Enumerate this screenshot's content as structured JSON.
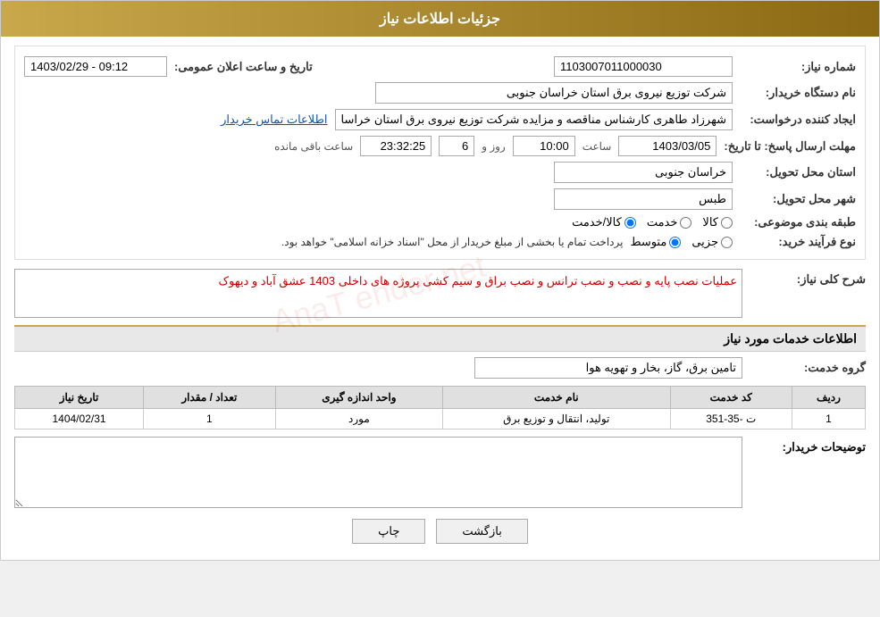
{
  "header": {
    "title": "جزئیات اطلاعات نیاز"
  },
  "form": {
    "need_number_label": "شماره نیاز:",
    "need_number_value": "1103007011000030",
    "announce_date_label": "تاریخ و ساعت اعلان عمومی:",
    "announce_date_value": "1403/02/29 - 09:12",
    "buyer_org_label": "نام دستگاه خریدار:",
    "buyer_org_value": "شرکت توزیع نیروی برق استان خراسان جنوبی",
    "creator_label": "ایجاد کننده درخواست:",
    "creator_value": "شهرزاد طاهری کارشناس مناقصه و مزایده شرکت توزیع نیروی برق استان خراسا",
    "creator_link": "اطلاعات تماس خریدار",
    "deadline_label": "مهلت ارسال پاسخ: تا تاریخ:",
    "deadline_date": "1403/03/05",
    "deadline_time_label": "ساعت",
    "deadline_time": "10:00",
    "deadline_day_label": "روز و",
    "deadline_days": "6",
    "deadline_remaining_label": "ساعت باقی مانده",
    "deadline_remaining": "23:32:25",
    "province_label": "استان محل تحویل:",
    "province_value": "خراسان جنوبی",
    "city_label": "شهر محل تحویل:",
    "city_value": "طبس",
    "category_label": "طبقه بندی موضوعی:",
    "category_options": [
      "کالا",
      "خدمت",
      "کالا/خدمت"
    ],
    "category_selected": "کالا",
    "purchase_type_label": "نوع فرآیند خرید:",
    "purchase_options": [
      "جزیی",
      "متوسط"
    ],
    "purchase_description": "پرداخت تمام یا بخشی از مبلغ خریدار از محل \"اسناد خزانه اسلامی\" خواهد بود.",
    "description_label": "شرح کلی نیاز:",
    "description_value": "عملیات نصب پایه و نصب و نصب ترانس و نصب براق و سیم کشی پروژه های داخلی 1403 عشق آباد و دیهوک",
    "services_section_title": "اطلاعات خدمات مورد نیاز",
    "service_group_label": "گروه خدمت:",
    "service_group_value": "تامین برق، گاز، بخار و تهویه هوا",
    "table": {
      "columns": [
        "ردیف",
        "کد خدمت",
        "نام خدمت",
        "واحد اندازه گیری",
        "تعداد / مقدار",
        "تاریخ نیاز"
      ],
      "rows": [
        {
          "row_num": "1",
          "service_code": "ت -35-351",
          "service_name": "تولید، انتقال و توزیع برق",
          "unit": "مورد",
          "quantity": "1",
          "need_date": "1404/02/31"
        }
      ]
    },
    "buyer_desc_label": "توضیحات خریدار:",
    "buyer_desc_value": "",
    "btn_back": "بازگشت",
    "btn_print": "چاپ"
  }
}
